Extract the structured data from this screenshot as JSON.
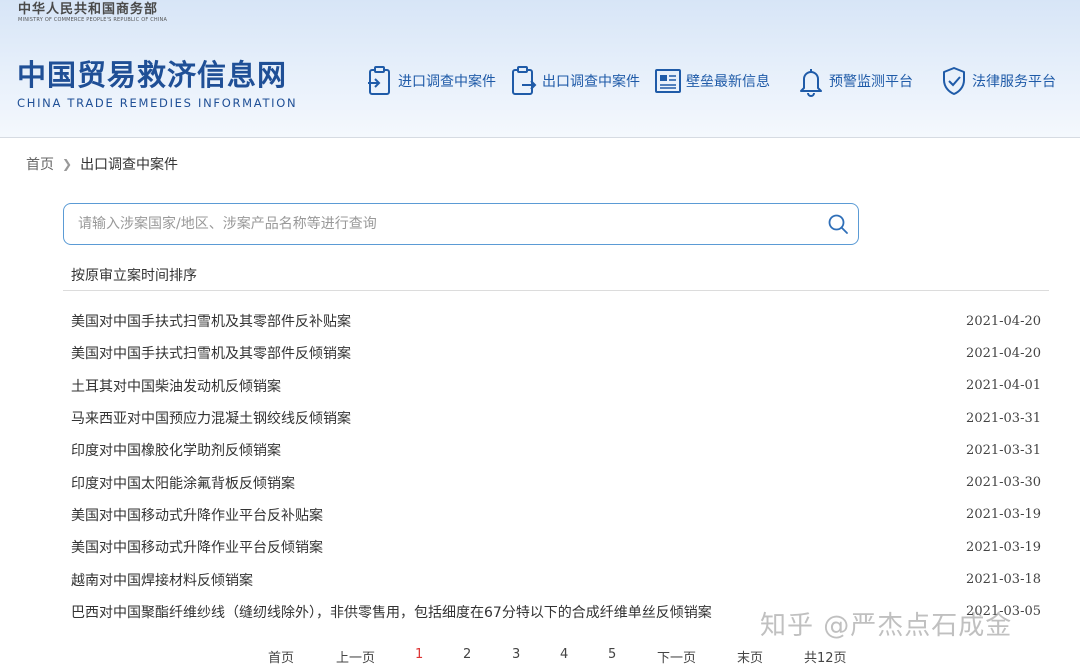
{
  "header": {
    "ministry_cn": "中华人民共和国商务部",
    "ministry_en": "MINISTRY OF COMMERCE PEOPLE'S REPUBLIC OF CHINA",
    "title_cn": "中国贸易救济信息网",
    "title_en": "CHINA TRADE REMEDIES INFORMATION",
    "accent_color": "#1f5ba8"
  },
  "nav": [
    {
      "label": "进口调查中案件",
      "icon": "import-case-icon"
    },
    {
      "label": "出口调查中案件",
      "icon": "export-case-icon"
    },
    {
      "label": "壁垒最新信息",
      "icon": "news-icon"
    },
    {
      "label": "预警监测平台",
      "icon": "bell-icon"
    },
    {
      "label": "法律服务平台",
      "icon": "shield-check-icon"
    }
  ],
  "breadcrumb": {
    "home": "首页",
    "current": "出口调查中案件"
  },
  "search": {
    "placeholder": "请输入涉案国家/地区、涉案产品名称等进行查询",
    "value": ""
  },
  "sort_label": "按原审立案时间排序",
  "cases": [
    {
      "title": "美国对中国手扶式扫雪机及其零部件反补贴案",
      "date": "2021-04-20"
    },
    {
      "title": "美国对中国手扶式扫雪机及其零部件反倾销案",
      "date": "2021-04-20"
    },
    {
      "title": "土耳其对中国柴油发动机反倾销案",
      "date": "2021-04-01"
    },
    {
      "title": "马来西亚对中国预应力混凝土钢绞线反倾销案",
      "date": "2021-03-31"
    },
    {
      "title": "印度对中国橡胶化学助剂反倾销案",
      "date": "2021-03-31"
    },
    {
      "title": "印度对中国太阳能涂氟背板反倾销案",
      "date": "2021-03-30"
    },
    {
      "title": "美国对中国移动式升降作业平台反补贴案",
      "date": "2021-03-19"
    },
    {
      "title": "美国对中国移动式升降作业平台反倾销案",
      "date": "2021-03-19"
    },
    {
      "title": "越南对中国焊接材料反倾销案",
      "date": "2021-03-18"
    },
    {
      "title": "巴西对中国聚酯纤维纱线（缝纫线除外），非供零售用，包括细度在67分特以下的合成纤维单丝反倾销案",
      "date": "2021-03-05"
    }
  ],
  "pagination": {
    "first": "首页",
    "prev": "上一页",
    "pages": [
      "1",
      "2",
      "3",
      "4",
      "5"
    ],
    "current": "1",
    "next": "下一页",
    "last": "末页",
    "total": "共12页"
  },
  "watermark": "知乎 @严杰点石成金"
}
